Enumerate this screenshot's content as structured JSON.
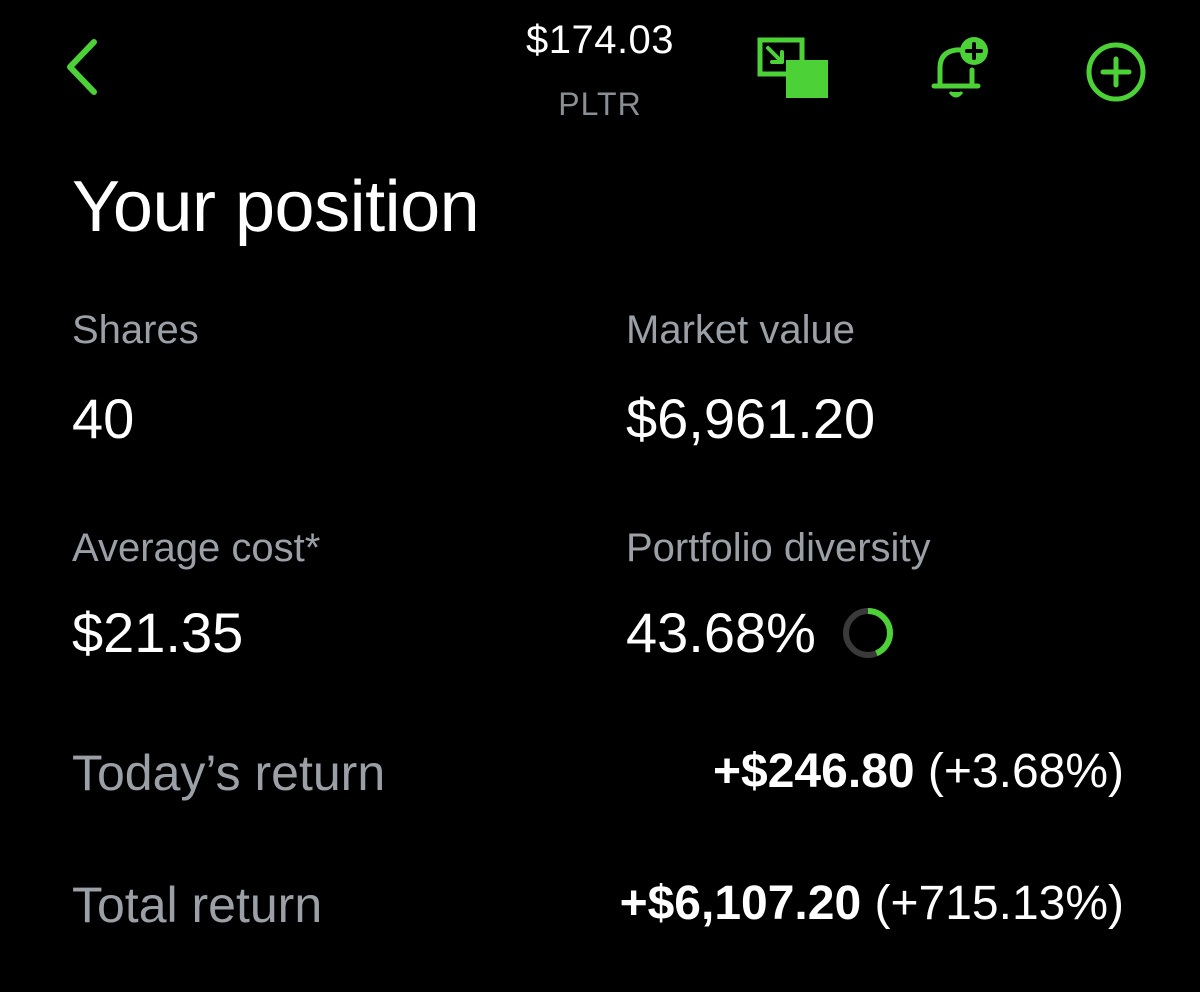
{
  "header": {
    "price": "$174.03",
    "ticker": "PLTR",
    "back_icon": "chevron-left-icon",
    "actions": [
      {
        "icon": "expand-screen-icon"
      },
      {
        "icon": "bell-plus-icon"
      },
      {
        "icon": "plus-circle-icon"
      }
    ]
  },
  "position": {
    "title": "Your position",
    "shares": {
      "label": "Shares",
      "value": "40"
    },
    "market_value": {
      "label": "Market value",
      "value": "$6,961.20"
    },
    "average_cost": {
      "label": "Average cost*",
      "value": "$21.35"
    },
    "portfolio_diversity": {
      "label": "Portfolio diversity",
      "value": "43.68%",
      "fraction": 0.4368,
      "icon": "progress-ring-icon"
    },
    "todays_return": {
      "label": "Today’s return",
      "amount": "+$246.80",
      "percent": "(+3.68%)"
    },
    "total_return": {
      "label": "Total return",
      "amount": "+$6,107.20",
      "percent": "(+715.13%)"
    }
  },
  "colors": {
    "accent": "#4cd137",
    "background": "#000000",
    "text_primary": "#ffffff",
    "text_secondary": "#9aa0a6",
    "ring_track": "#3a3a3a"
  }
}
